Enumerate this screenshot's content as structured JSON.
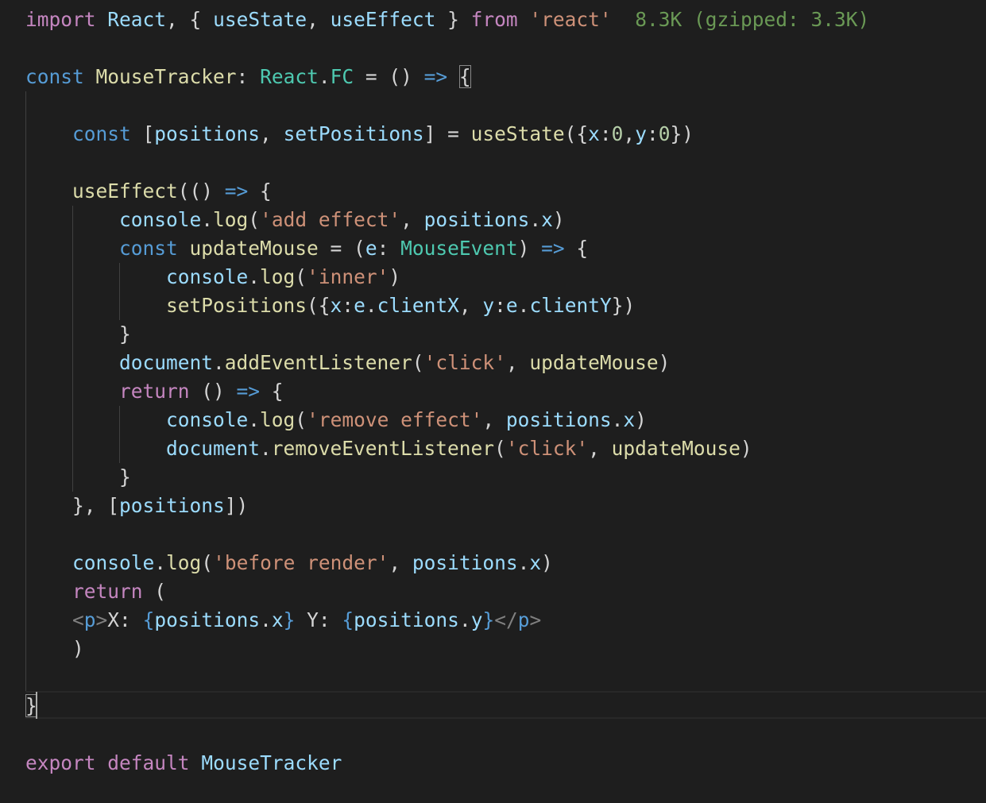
{
  "editor": {
    "language": "typescriptreact",
    "theme_colors": {
      "background": "#1e1e1e",
      "text": "#d4d4d4",
      "keyword": "#569cd6",
      "control": "#c586c0",
      "variable": "#9cdcfe",
      "function": "#dcdcaa",
      "type": "#4ec9b0",
      "string": "#ce9178",
      "number": "#b5cea8",
      "import_cost": "#6a9955"
    }
  },
  "import_cost": {
    "label": "8.3K (gzipped: 3.3K)"
  },
  "code": {
    "l1": {
      "import": "import",
      "react": "React",
      "p1": ", { ",
      "useState": "useState",
      "p2": ", ",
      "useEffect": "useEffect",
      "p3": " } ",
      "from": "from",
      "src": "'react'"
    },
    "l3": {
      "const": "const",
      "name": "MouseTracker",
      "colon": ": ",
      "react": "React",
      "dot": ".",
      "fc": "FC",
      "eq": " = () ",
      "arrow": "=>",
      "sp": " ",
      "brace": "{"
    },
    "l5": {
      "const": "const",
      "open": " [",
      "positions": "positions",
      "comma": ", ",
      "setPositions": "setPositions",
      "eq": "] = ",
      "useState": "useState",
      "p1": "({",
      "x": "x",
      "c1": ":",
      "zero1": "0",
      "c2": ",",
      "y": "y",
      "c3": ":",
      "zero2": "0",
      "close": "})"
    },
    "l7": {
      "useEffect": "useEffect",
      "p1": "(() ",
      "arrow": "=>",
      "p2": " {"
    },
    "l8": {
      "console": "console",
      "dot": ".",
      "log": "log",
      "p1": "(",
      "str": "'add effect'",
      "p2": ", ",
      "positions": "positions",
      "dot2": ".",
      "x": "x",
      "p3": ")"
    },
    "l9": {
      "const": "const",
      "sp": " ",
      "name": "updateMouse",
      "p1": " = (",
      "e": "e",
      "colon": ": ",
      "type": "MouseEvent",
      "p2": ") ",
      "arrow": "=>",
      "p3": " {"
    },
    "l10": {
      "console": "console",
      "dot": ".",
      "log": "log",
      "p1": "(",
      "str": "'inner'",
      "p2": ")"
    },
    "l11": {
      "fn": "setPositions",
      "p1": "({",
      "x": "x",
      "c1": ":",
      "e1": "e",
      "d1": ".",
      "clientX": "clientX",
      "p2": ", ",
      "y": "y",
      "c2": ":",
      "e2": "e",
      "d2": ".",
      "clientY": "clientY",
      "p3": "})"
    },
    "l12": {
      "brace": "}"
    },
    "l13": {
      "document": "document",
      "dot": ".",
      "fn": "addEventListener",
      "p1": "(",
      "str": "'click'",
      "p2": ", ",
      "arg": "updateMouse",
      "p3": ")"
    },
    "l14": {
      "return": "return",
      "p1": " () ",
      "arrow": "=>",
      "p2": " {"
    },
    "l15": {
      "console": "console",
      "dot": ".",
      "log": "log",
      "p1": "(",
      "str": "'remove effect'",
      "p2": ", ",
      "positions": "positions",
      "dot2": ".",
      "x": "x",
      "p3": ")"
    },
    "l16": {
      "document": "document",
      "dot": ".",
      "fn": "removeEventListener",
      "p1": "(",
      "str": "'click'",
      "p2": ", ",
      "arg": "updateMouse",
      "p3": ")"
    },
    "l17": {
      "brace": "}"
    },
    "l18": {
      "p1": "}, [",
      "positions": "positions",
      "p2": "])"
    },
    "l20": {
      "console": "console",
      "dot": ".",
      "log": "log",
      "p1": "(",
      "str": "'before render'",
      "p2": ", ",
      "positions": "positions",
      "dot2": ".",
      "x": "x",
      "p3": ")"
    },
    "l21": {
      "return": "return",
      "p1": " ("
    },
    "l22": {
      "lt1": "<",
      "tag1": "p",
      "gt1": ">",
      "text1": "X: ",
      "ob1": "{",
      "positions1": "positions",
      "d1": ".",
      "x": "x",
      "cb1": "}",
      "text2": " Y: ",
      "ob2": "{",
      "positions2": "positions",
      "d2": ".",
      "y": "y",
      "cb2": "}",
      "lt2": "</",
      "tag2": "p",
      "gt2": ">"
    },
    "l23": {
      "paren": ")"
    },
    "l25": {
      "brace": "}"
    },
    "l27": {
      "export": "export",
      "sp1": " ",
      "default": "default",
      "sp2": " ",
      "name": "MouseTracker"
    }
  }
}
